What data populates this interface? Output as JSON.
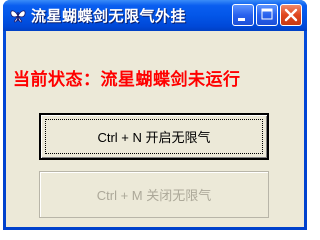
{
  "window": {
    "title": "流星蝴蝶剑无限气外挂",
    "app_icon": "butterfly-icon",
    "controls": [
      "minimize-icon",
      "maximize-icon",
      "close-icon"
    ]
  },
  "status": {
    "text": "当前状态：流星蝴蝶剑未运行",
    "color": "#ff0000"
  },
  "buttons": {
    "enable_label": "Ctrl + N   开启无限气",
    "disable_label": "Ctrl + M   关闭无限气"
  },
  "colors": {
    "titlebar": "#0356e8",
    "client_bg": "#ece9d8",
    "close_button": "#e0471f",
    "disabled_text": "#aca899"
  }
}
